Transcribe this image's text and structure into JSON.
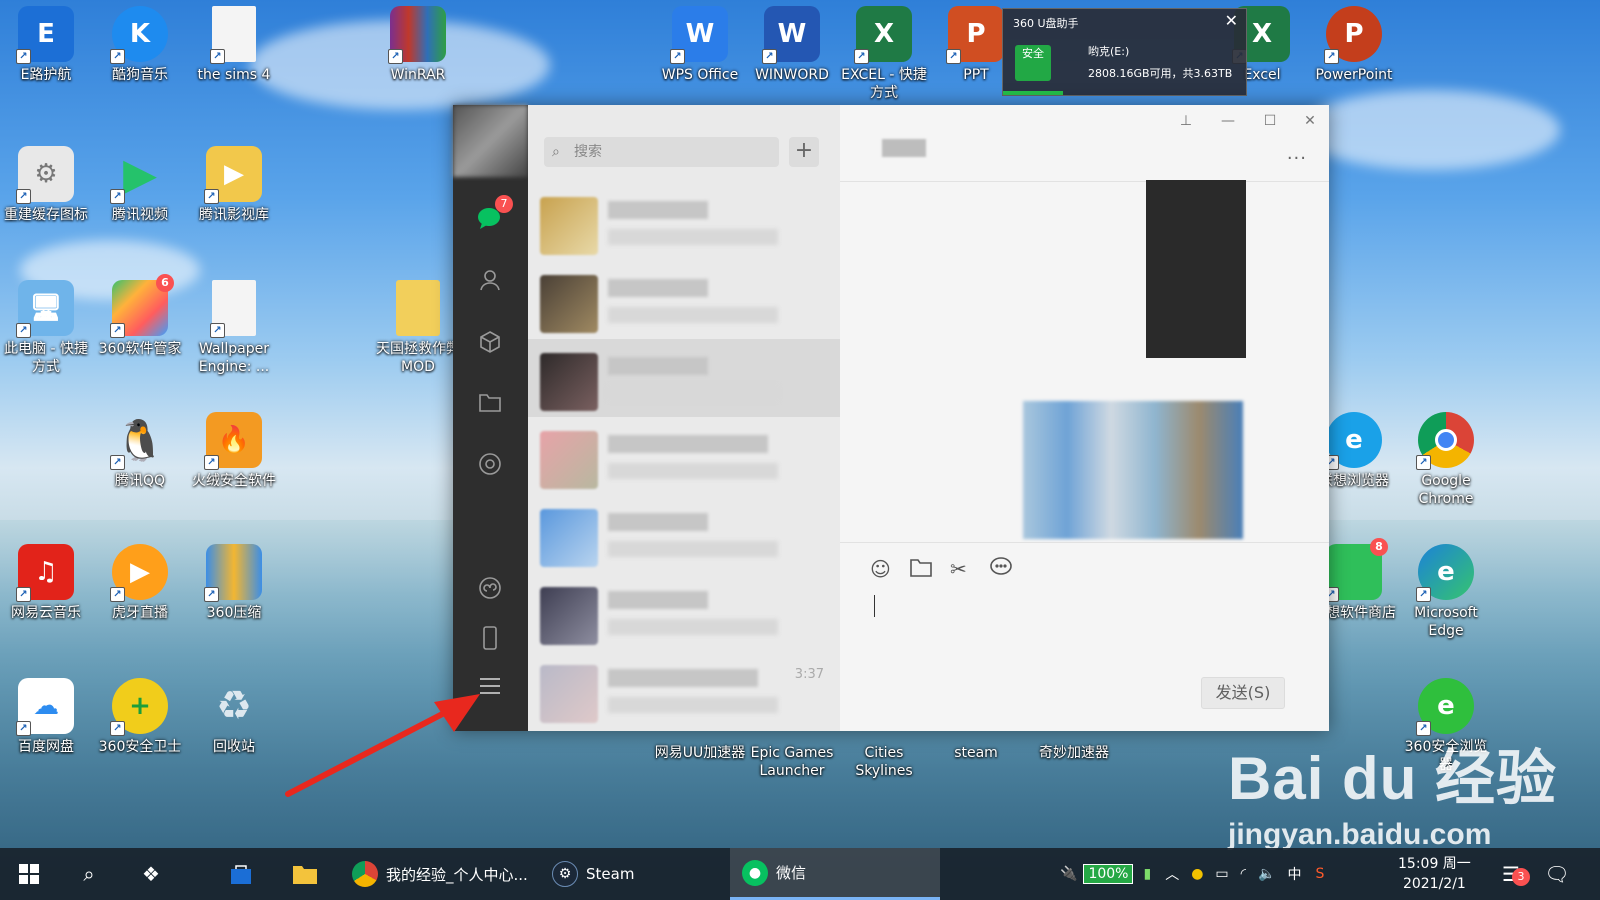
{
  "desktop": {
    "icons": [
      {
        "label": "E路护航"
      },
      {
        "label": "酷狗音乐"
      },
      {
        "label": "the sims 4"
      },
      {
        "label": "WinRAR"
      },
      {
        "label": "WPS Office"
      },
      {
        "label": "WINWORD"
      },
      {
        "label": "EXCEL - 快捷方式"
      },
      {
        "label": "PPT"
      },
      {
        "label": "Excel"
      },
      {
        "label": "PowerPoint"
      },
      {
        "label": "重建缓存图标"
      },
      {
        "label": "腾讯视频"
      },
      {
        "label": "腾讯影视库"
      },
      {
        "label": "此电脑 - 快捷方式"
      },
      {
        "label": "360软件管家"
      },
      {
        "label": "Wallpaper Engine: ..."
      },
      {
        "label": "天国拯救作弊MOD"
      },
      {
        "label": "腾讯QQ"
      },
      {
        "label": "火绒安全软件"
      },
      {
        "label": "联想浏览器"
      },
      {
        "label": "Google Chrome"
      },
      {
        "label": "网易云音乐"
      },
      {
        "label": "虎牙直播"
      },
      {
        "label": "360压缩"
      },
      {
        "label": "联想软件商店"
      },
      {
        "label": "Microsoft Edge"
      },
      {
        "label": "百度网盘"
      },
      {
        "label": "360安全卫士"
      },
      {
        "label": "回收站"
      },
      {
        "label": "网易UU加速器"
      },
      {
        "label": "Epic Games Launcher"
      },
      {
        "label": "Cities Skylines"
      },
      {
        "label": "steam"
      },
      {
        "label": "奇妙加速器"
      },
      {
        "label": "360安全浏览器"
      }
    ],
    "badges": {
      "software_manager": "6",
      "store": "8"
    }
  },
  "notification": {
    "title": "360 U盘助手",
    "safe_label": "安全",
    "drive": "哟克(E:)",
    "space": "2808.16GB可用，共3.63TB"
  },
  "wechat": {
    "unread_badge": "7",
    "search_placeholder": "搜索",
    "plus": "+",
    "last_time": "3:37",
    "send_label": "发送(S)",
    "more_label": "..."
  },
  "watermark": {
    "brand": "Bai du 经验",
    "url": "jingyan.baidu.com"
  },
  "taskbar": {
    "apps": [
      {
        "label": "我的经验_个人中心..."
      },
      {
        "label": "Steam"
      },
      {
        "label": "微信"
      }
    ],
    "battery": "100%",
    "ime": "中",
    "time": "15:09 周一",
    "date": "2021/2/1",
    "notification_count": "3"
  },
  "colors": {
    "wechat_green": "#07c160",
    "badge_red": "#fa5151",
    "sidebar_dark": "#2e2e2e",
    "annotation_red": "#e8281e"
  }
}
